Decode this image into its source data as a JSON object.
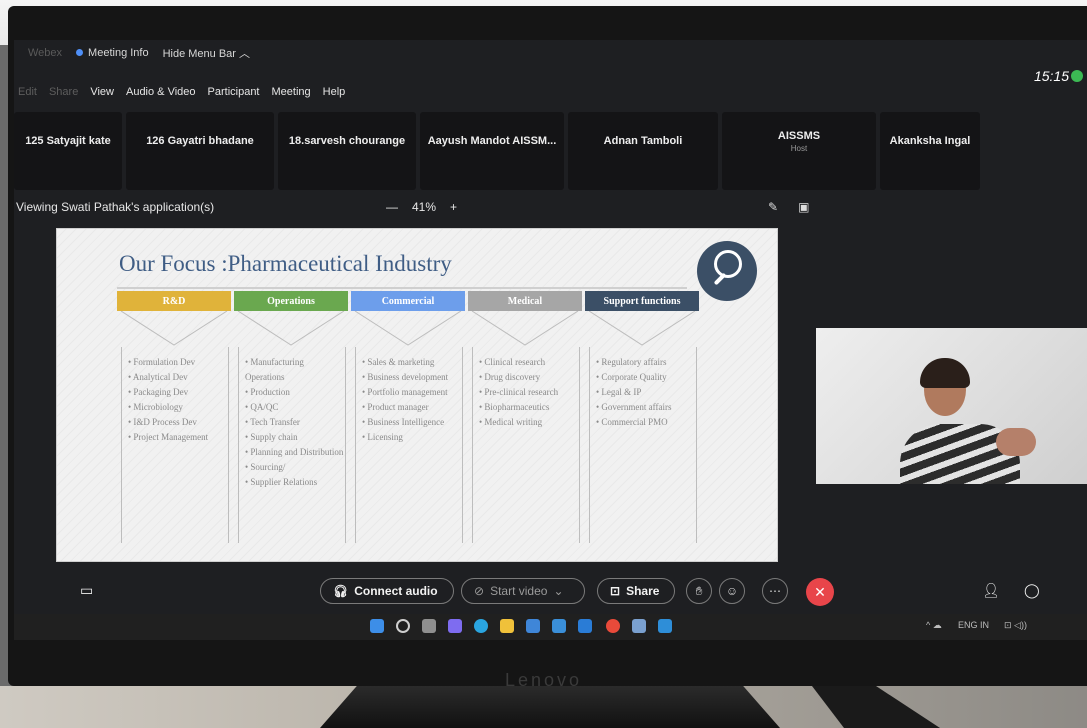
{
  "menu_bar": {
    "webex_label": "Webex",
    "meeting_info": "Meeting Info",
    "hide_menu_bar": "Hide Menu Bar",
    "items": [
      "Edit",
      "Share",
      "View",
      "Audio & Video",
      "Participant",
      "Meeting",
      "Help"
    ]
  },
  "clock": "15:15",
  "participants": [
    {
      "name": "125 Satyajit kate"
    },
    {
      "name": "126 Gayatri bhadane"
    },
    {
      "name": "18.sarvesh chourange"
    },
    {
      "name": "Aayush Mandot AISSM..."
    },
    {
      "name": "Adnan Tamboli"
    },
    {
      "name": "AISSMS",
      "role": "Host"
    },
    {
      "name": "Akanksha Ingal"
    }
  ],
  "viewing_label": "Viewing Swati Pathak's application(s)",
  "zoom": {
    "minus": "—",
    "level": "41%",
    "plus": "+"
  },
  "slide": {
    "title": "Our Focus :Pharmaceutical Industry",
    "columns": [
      {
        "head": "R&D",
        "color": "#e0b33a",
        "items": [
          "Formulation Dev",
          "Analytical Dev",
          "Packaging Dev",
          "Microbiology",
          "I&D Process Dev",
          "Project Management"
        ]
      },
      {
        "head": "Operations",
        "color": "#6aa84f",
        "items": [
          "Manufacturing Operations",
          "Production",
          "QA/QC",
          "Tech Transfer",
          "Supply chain",
          "Planning and Distribution",
          "Sourcing/",
          "Supplier Relations"
        ]
      },
      {
        "head": "Commercial",
        "color": "#6d9eeb",
        "items": [
          "Sales & marketing",
          "Business development",
          "Portfolio management",
          "Product manager",
          "Business Intelligence",
          "Licensing"
        ]
      },
      {
        "head": "Medical",
        "color": "#a6a6a6",
        "items": [
          "Clinical research",
          "Drug discovery",
          "Pre-clinical research",
          "Biopharmaceutics",
          "Medical writing"
        ]
      },
      {
        "head": "Support functions",
        "color": "#3b4f66",
        "items": [
          "Regulatory affairs",
          "Corporate Quality",
          "Legal & IP",
          "Government affairs",
          "Commercial PMO"
        ]
      }
    ]
  },
  "controls": {
    "connect_audio": "Connect audio",
    "start_video": "Start video",
    "share": "Share"
  },
  "brand": "Lenovo"
}
